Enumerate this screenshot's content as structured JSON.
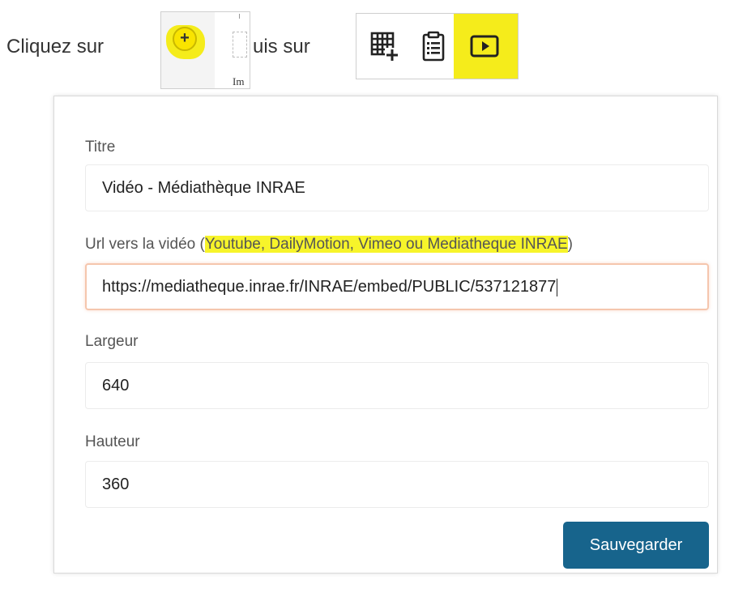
{
  "instruction": {
    "part1": "Cliquez sur",
    "part2": "uis sur"
  },
  "step1_crop": {
    "plus_symbol": "+",
    "partial_label": "Im"
  },
  "toolbar_crop": {
    "icons": [
      "table-add-icon",
      "clipboard-list-icon",
      "video-play-icon"
    ],
    "highlighted": "video-play-icon",
    "highlight_color": "#f5ec1b"
  },
  "form": {
    "title_label": "Titre",
    "title_value": "Vidéo - Médiathèque INRAE",
    "url_label_prefix": "Url vers la vidéo (",
    "url_label_highlight": "Youtube, DailyMotion, Vimeo ou Mediatheque INRAE",
    "url_label_suffix": ")",
    "url_value": "https://mediatheque.inrae.fr/INRAE/embed/PUBLIC/537121877",
    "width_label": "Largeur",
    "width_value": "640",
    "height_label": "Hauteur",
    "height_value": "360",
    "save_label": "Sauvegarder"
  },
  "colors": {
    "highlight": "#f5ec1b",
    "save_button": "#17648c",
    "focus_border": "#f5c6ad"
  }
}
